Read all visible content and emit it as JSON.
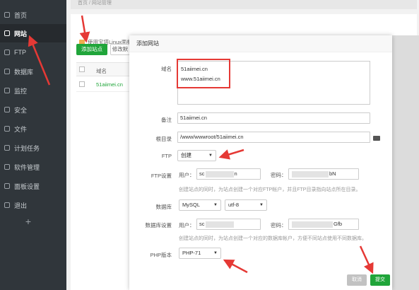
{
  "sidebar": {
    "items": [
      {
        "label": "首页",
        "icon": "home-icon"
      },
      {
        "label": "网站",
        "icon": "globe-icon"
      },
      {
        "label": "FTP",
        "icon": "ftp-icon"
      },
      {
        "label": "数据库",
        "icon": "database-icon"
      },
      {
        "label": "监控",
        "icon": "monitor-icon"
      },
      {
        "label": "安全",
        "icon": "shield-icon"
      },
      {
        "label": "文件",
        "icon": "folder-icon"
      },
      {
        "label": "计划任务",
        "icon": "calendar-icon"
      },
      {
        "label": "软件管理",
        "icon": "apps-icon"
      },
      {
        "label": "面板设置",
        "icon": "settings-icon"
      },
      {
        "label": "退出",
        "icon": "logout-icon"
      }
    ],
    "add_label": "+"
  },
  "background": {
    "breadcrumb": "首页 / 网站管理",
    "notice": "使用宝塔Linux面板创建站点时会自动创建权限配置，统一使用www用户。",
    "add_site_button": "添加站点",
    "modify_button": "修改默",
    "table_header_name": "域名",
    "site_name": "51aiimei.cn"
  },
  "modal": {
    "title": "添加网站",
    "domain_label": "域名",
    "domain_lines": [
      "51aiimei.cn",
      "www.51aiimei.cn"
    ],
    "note_label": "备注",
    "note_value": "51aiimei.cn",
    "root_label": "根目录",
    "root_value": "/www/wwwroot/51aiimei.cn",
    "ftp_label": "FTP",
    "ftp_value": "创建",
    "ftp_settings_label": "FTP设置",
    "user_label": "用户：",
    "password_label": "密码：",
    "ftp_user_start": "sc",
    "ftp_user_end": "n",
    "ftp_pwd_end": "bN",
    "ftp_help": "创建站点的同时，为站点创建一个对应FTP帐户，并且FTP目录指向站点所在目录。",
    "db_label": "数据库",
    "db_type": "MySQL",
    "db_charset": "utf-8",
    "db_settings_label": "数据库设置",
    "db_user_start": "sc",
    "db_pwd_end": "Gfb",
    "db_help": "创建站点的同时，为站点创建一个对应的数据库帐户，方便不同站点使用不同数据库。",
    "php_label": "PHP版本",
    "php_value": "PHP-71",
    "cancel_button": "取消",
    "submit_button": "提交"
  },
  "colors": {
    "sidebar_bg": "#30363b",
    "accent_green": "#20a53a",
    "annotation_red": "#e53935"
  }
}
